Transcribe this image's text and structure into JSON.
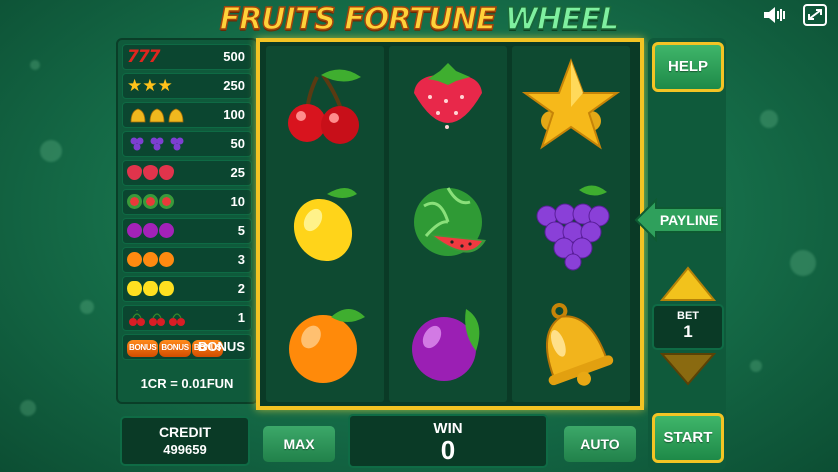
{
  "title": {
    "part1": "FRUITS FORTUNE",
    "part2": "WHEEL"
  },
  "icons": {
    "sound": "speaker-icon",
    "fullscreen": "fullscreen-icon"
  },
  "paytable": {
    "rows": [
      {
        "symbol": "seven",
        "value": "500"
      },
      {
        "symbol": "star",
        "value": "250"
      },
      {
        "symbol": "bell",
        "value": "100"
      },
      {
        "symbol": "grapes",
        "value": "50"
      },
      {
        "symbol": "strawberry",
        "value": "25"
      },
      {
        "symbol": "watermelon",
        "value": "10"
      },
      {
        "symbol": "plum",
        "value": "5"
      },
      {
        "symbol": "orange",
        "value": "3"
      },
      {
        "symbol": "lemon",
        "value": "2"
      },
      {
        "symbol": "cherry",
        "value": "1"
      },
      {
        "symbol": "bonus",
        "value": "BONUS"
      }
    ],
    "bonus_text": "BONUS",
    "rate": "1CR = 0.01FUN"
  },
  "reels": [
    [
      "cherry",
      "lemon",
      "orange"
    ],
    [
      "strawberry",
      "watermelon",
      "plum"
    ],
    [
      "star",
      "grapes",
      "bell"
    ]
  ],
  "controls": {
    "help": "HELP",
    "payline": "PAYLINE",
    "bet_label": "BET",
    "bet_value": "1",
    "credit_label": "CREDIT",
    "credit_value": "499659",
    "max": "MAX",
    "win_label": "WIN",
    "win_value": "0",
    "auto": "AUTO",
    "start": "START"
  },
  "colors": {
    "accent_gold": "#f3c424",
    "button_green": "#2ea55a",
    "panel_dark": "#0a3a26"
  }
}
